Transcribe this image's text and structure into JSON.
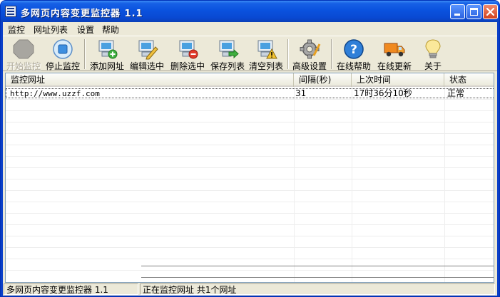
{
  "window": {
    "title": "多网页内容变更监控器 1.1"
  },
  "menu": {
    "items": [
      "监控",
      "网址列表",
      "设置",
      "帮助"
    ]
  },
  "toolbar": {
    "buttons": [
      {
        "label": "开始监控",
        "icon": "start-monitor-icon",
        "enabled": false
      },
      {
        "label": "停止监控",
        "icon": "stop-monitor-icon",
        "enabled": true
      },
      {
        "label": "添加网址",
        "icon": "add-url-icon",
        "enabled": true
      },
      {
        "label": "编辑选中",
        "icon": "edit-selected-icon",
        "enabled": true
      },
      {
        "label": "删除选中",
        "icon": "delete-selected-icon",
        "enabled": true
      },
      {
        "label": "保存列表",
        "icon": "save-list-icon",
        "enabled": true
      },
      {
        "label": "清空列表",
        "icon": "clear-list-icon",
        "enabled": true
      },
      {
        "label": "高级设置",
        "icon": "gear-icon",
        "enabled": true
      },
      {
        "label": "在线帮助",
        "icon": "help-icon",
        "enabled": true
      },
      {
        "label": "在线更新",
        "icon": "truck-icon",
        "enabled": true
      },
      {
        "label": "关于",
        "icon": "lightbulb-icon",
        "enabled": true
      }
    ]
  },
  "table": {
    "columns": [
      "监控网址",
      "间隔(秒)",
      "上次时间",
      "状态"
    ],
    "rows": [
      {
        "url": "http://www.uzzf.com",
        "interval": "31",
        "last_time": "17时36分10秒",
        "status": "正常"
      }
    ]
  },
  "status": {
    "app_name": "多网页内容变更监控器 1.1",
    "message": "正在监控网址 共1个网址"
  }
}
